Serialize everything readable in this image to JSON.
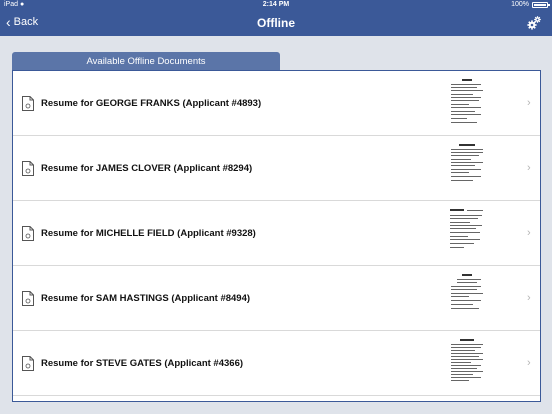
{
  "status_bar": {
    "carrier": "iPad",
    "time": "2:14 PM",
    "battery": "100%"
  },
  "nav": {
    "back_label": "Back",
    "title": "Offline"
  },
  "tab": {
    "label": "Available Offline Documents"
  },
  "documents": [
    {
      "title": "Resume for GEORGE FRANKS (Applicant #4893)"
    },
    {
      "title": "Resume for JAMES CLOVER (Applicant #8294)"
    },
    {
      "title": "Resume for MICHELLE FIELD (Applicant #9328)"
    },
    {
      "title": "Resume for SAM HASTINGS (Applicant #8494)"
    },
    {
      "title": "Resume for STEVE GATES (Applicant #4366)"
    }
  ],
  "colors": {
    "nav_bar": "#3b5998",
    "tab": "#5b75a8",
    "background": "#dfe3ea"
  }
}
